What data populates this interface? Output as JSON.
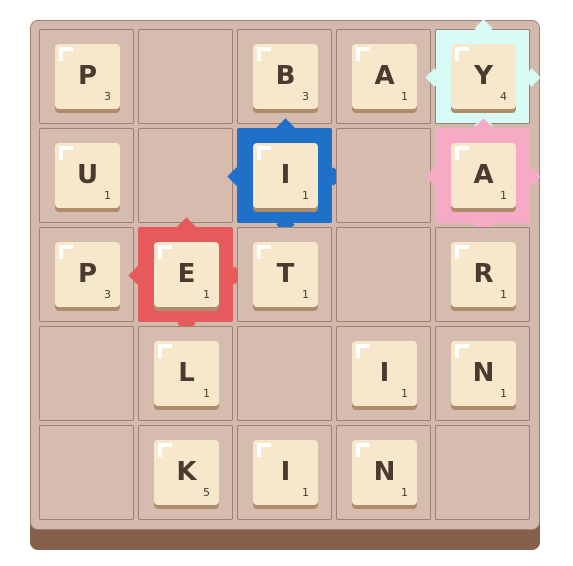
{
  "board": {
    "rows": 5,
    "cols": 5,
    "colors": {
      "board_bg": "#d2b9ac",
      "board_shadow": "#86604a",
      "tile": "#f7e8cc",
      "text": "#4b3a30",
      "bonus_red": "#e65a5c",
      "bonus_blue": "#1f70c9",
      "bonus_pink": "#f6aac6",
      "bonus_cyan": "#d8fbf6"
    },
    "cells": [
      [
        {
          "letter": "P",
          "score": "3",
          "bonus": null
        },
        {
          "letter": null,
          "score": null,
          "bonus": null
        },
        {
          "letter": "B",
          "score": "3",
          "bonus": null
        },
        {
          "letter": "A",
          "score": "1",
          "bonus": null
        },
        {
          "letter": "Y",
          "score": "4",
          "bonus": "cyan"
        }
      ],
      [
        {
          "letter": "U",
          "score": "1",
          "bonus": null
        },
        {
          "letter": null,
          "score": null,
          "bonus": null
        },
        {
          "letter": "I",
          "score": "1",
          "bonus": "blue"
        },
        {
          "letter": null,
          "score": null,
          "bonus": null
        },
        {
          "letter": "A",
          "score": "1",
          "bonus": "pink"
        }
      ],
      [
        {
          "letter": "P",
          "score": "3",
          "bonus": null
        },
        {
          "letter": "E",
          "score": "1",
          "bonus": "red"
        },
        {
          "letter": "T",
          "score": "1",
          "bonus": null
        },
        {
          "letter": null,
          "score": null,
          "bonus": null
        },
        {
          "letter": "R",
          "score": "1",
          "bonus": null
        }
      ],
      [
        {
          "letter": null,
          "score": null,
          "bonus": null
        },
        {
          "letter": "L",
          "score": "1",
          "bonus": null
        },
        {
          "letter": null,
          "score": null,
          "bonus": null
        },
        {
          "letter": "I",
          "score": "1",
          "bonus": null
        },
        {
          "letter": "N",
          "score": "1",
          "bonus": null
        }
      ],
      [
        {
          "letter": null,
          "score": null,
          "bonus": null
        },
        {
          "letter": "K",
          "score": "5",
          "bonus": null
        },
        {
          "letter": "I",
          "score": "1",
          "bonus": null
        },
        {
          "letter": "N",
          "score": "1",
          "bonus": null
        },
        {
          "letter": null,
          "score": null,
          "bonus": null
        }
      ]
    ]
  }
}
